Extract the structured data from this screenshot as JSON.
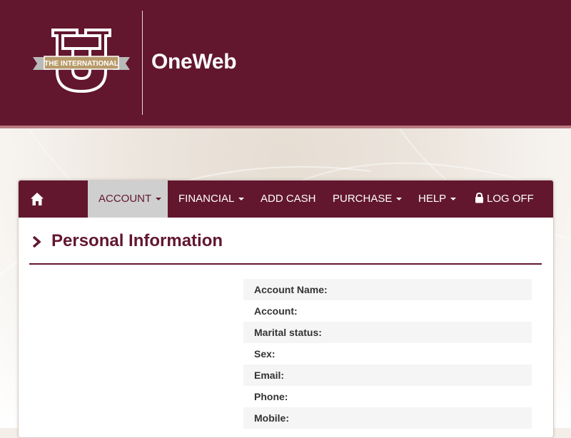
{
  "header": {
    "logo_text": "THE INTERNATIONAL",
    "brand": "OneWeb",
    "colors": {
      "maroon": "#62172f",
      "gold": "#b89a6a"
    }
  },
  "nav": {
    "home_icon": "home-icon",
    "items": [
      {
        "label": "ACCOUNT",
        "dropdown": true,
        "active": true
      },
      {
        "label": "FINANCIAL",
        "dropdown": true,
        "active": false
      },
      {
        "label": "ADD CASH",
        "dropdown": false,
        "active": false
      },
      {
        "label": "PURCHASE",
        "dropdown": true,
        "active": false
      },
      {
        "label": "HELP",
        "dropdown": true,
        "active": false
      },
      {
        "label": "LOG OFF",
        "dropdown": false,
        "active": false,
        "icon": "lock-icon"
      }
    ]
  },
  "main": {
    "title": "Personal Information",
    "fields": [
      {
        "label": "Account Name:"
      },
      {
        "label": "Account:"
      },
      {
        "label": "Marital status:"
      },
      {
        "label": "Sex:"
      },
      {
        "label": "Email:"
      },
      {
        "label": "Phone:"
      },
      {
        "label": "Mobile:"
      }
    ]
  }
}
